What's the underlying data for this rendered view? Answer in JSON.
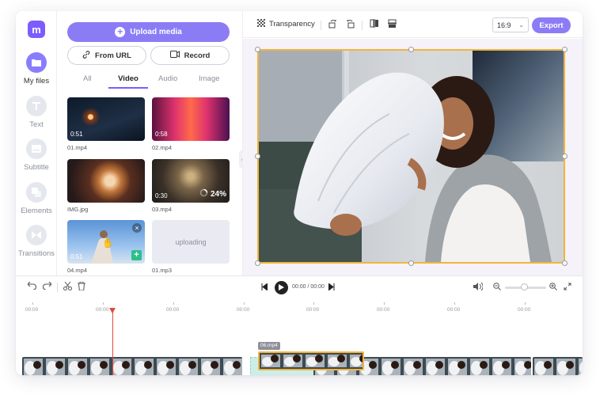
{
  "app": {
    "logo_letter": "m"
  },
  "rail": {
    "items": [
      {
        "label": "My files",
        "icon": "folder-icon"
      },
      {
        "label": "Text",
        "icon": "text-icon"
      },
      {
        "label": "Subtitle",
        "icon": "subtitle-icon"
      },
      {
        "label": "Elements",
        "icon": "elements-icon"
      },
      {
        "label": "Transitions",
        "icon": "transitions-icon"
      }
    ]
  },
  "panel": {
    "upload_label": "Upload media",
    "from_url_label": "From URL",
    "record_label": "Record",
    "tabs": [
      "All",
      "Video",
      "Audio",
      "Image"
    ],
    "active_tab": "Video",
    "media": [
      {
        "name": "01.mp4",
        "duration": "0:51"
      },
      {
        "name": "02.mp4",
        "duration": "0:58"
      },
      {
        "name": "IMG.jpg",
        "duration": ""
      },
      {
        "name": "03.mp4",
        "duration": "0:30",
        "progress": "24%"
      },
      {
        "name": "04.mp4",
        "duration": "0:51"
      },
      {
        "name": "01.mp3",
        "status": "uploading"
      }
    ]
  },
  "toolbar": {
    "transparency_label": "Transparency",
    "aspect_ratio": "16:9",
    "export_label": "Export"
  },
  "timeline": {
    "timecode": "00:00 / 00:00",
    "ruler_labels": [
      "00:00",
      "00:00",
      "00:00",
      "00:00",
      "00:00",
      "00:00",
      "00:00",
      "00:00"
    ],
    "selected_clip_name": "06.mp4"
  },
  "colors": {
    "accent": "#8b7cf6",
    "selection": "#f2b43c",
    "playhead": "#e04a3a",
    "add_green": "#2bbf8a"
  }
}
